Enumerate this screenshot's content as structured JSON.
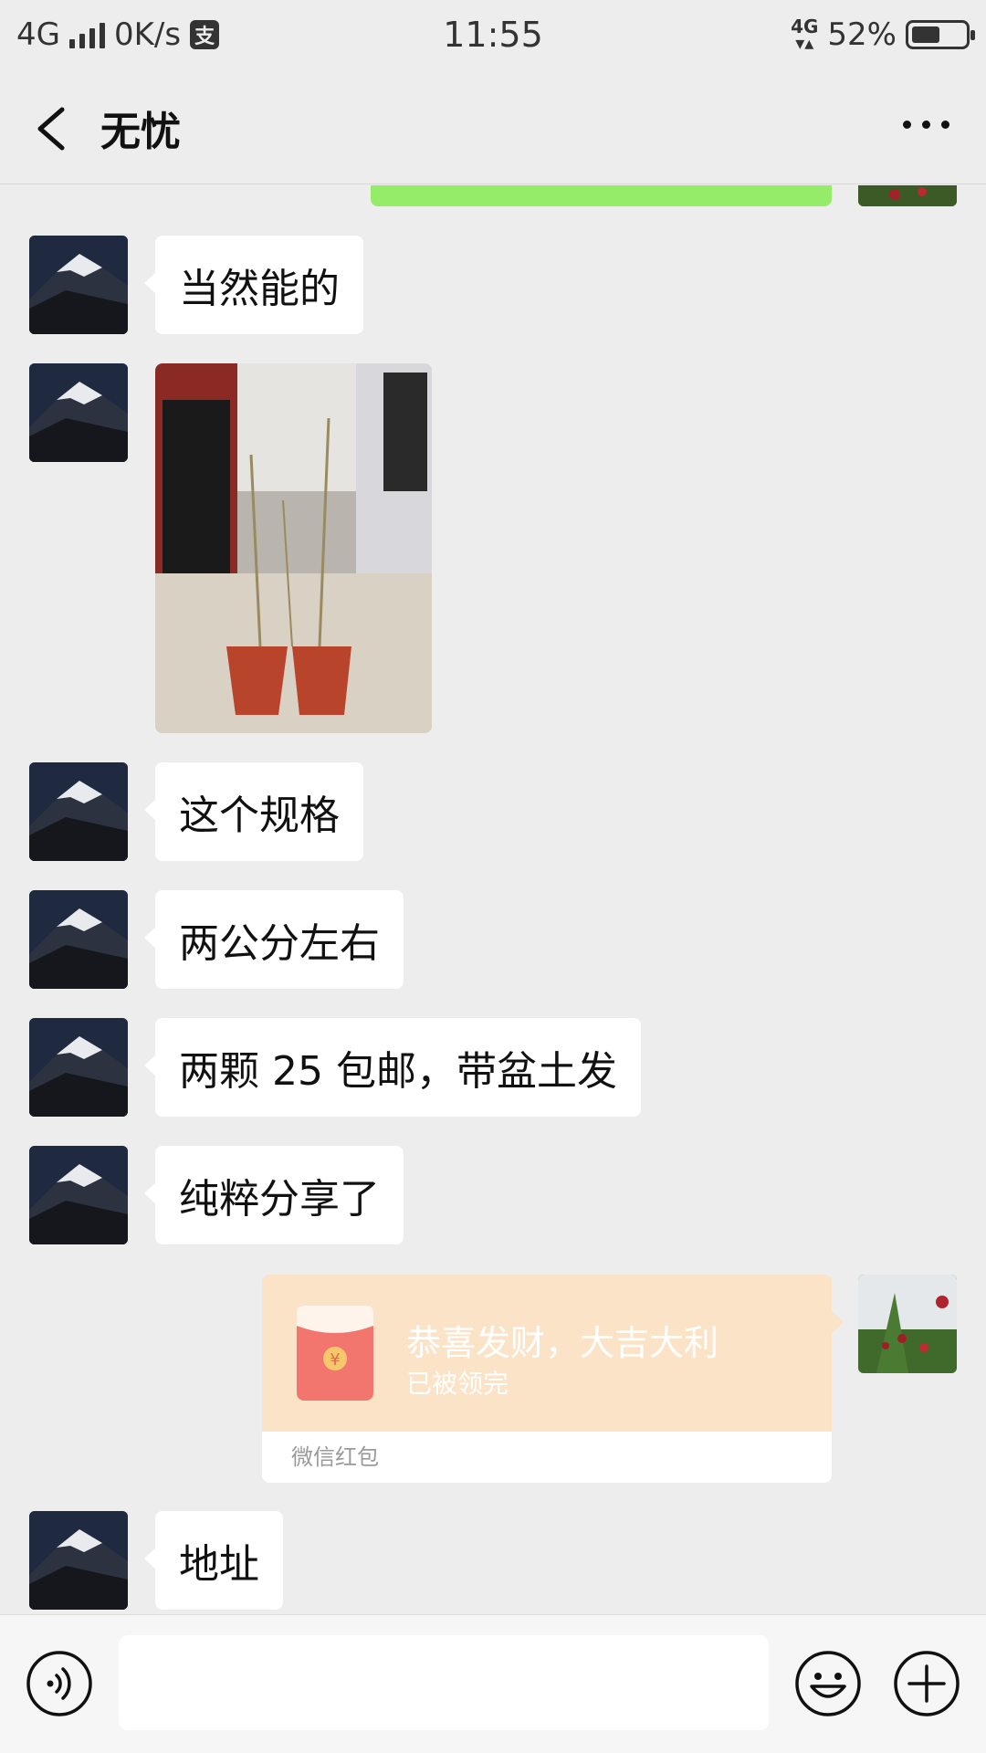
{
  "status_bar": {
    "network": "4G",
    "speed": "0K/s",
    "pay_glyph": "支",
    "time": "11:55",
    "network_right": "4G",
    "battery_percent": "52%",
    "battery_level": 0.52
  },
  "nav": {
    "title": "无忧",
    "back_icon": "chevron-left-icon",
    "more_icon": "more-dots-icon"
  },
  "messages": [
    {
      "side": "left",
      "type": "text",
      "text": "当然能的"
    },
    {
      "side": "left",
      "type": "image",
      "description_icon": "photo"
    },
    {
      "side": "left",
      "type": "text",
      "text": "这个规格"
    },
    {
      "side": "left",
      "type": "text",
      "text": "两公分左右"
    },
    {
      "side": "left",
      "type": "text",
      "text": "两颗 25 包邮，带盆土发"
    },
    {
      "side": "left",
      "type": "text",
      "text": "纯粹分享了"
    },
    {
      "side": "right",
      "type": "red_packet",
      "title": "恭喜发财，大吉大利",
      "status": "已被领完",
      "footer": "微信红包"
    },
    {
      "side": "left",
      "type": "text",
      "text": "地址"
    }
  ],
  "input_bar": {
    "placeholder": "",
    "voice_icon": "voice-icon",
    "emoji_icon": "emoji-icon",
    "plus_icon": "plus-icon"
  },
  "colors": {
    "background": "#ededed",
    "bubble_incoming": "#ffffff",
    "bubble_outgoing": "#95ec69",
    "red_packet": "#fbe3c7"
  }
}
